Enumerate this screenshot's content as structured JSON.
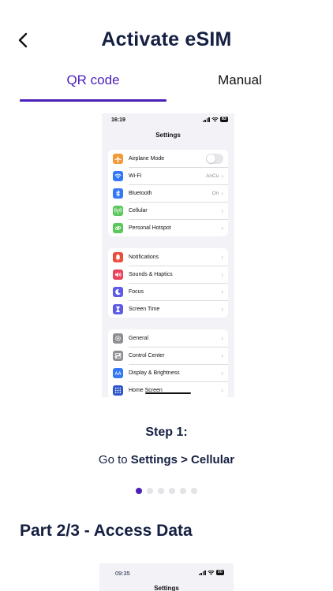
{
  "header": {
    "title": "Activate eSIM",
    "back_icon": "chevron-left-icon"
  },
  "tabs": [
    {
      "label": "QR code",
      "active": true
    },
    {
      "label": "Manual",
      "active": false
    }
  ],
  "colors": {
    "accent": "#4a1fb8",
    "text": "#152042"
  },
  "phone": {
    "time": "16:19",
    "battery": "83",
    "screen_title": "Settings",
    "groups": [
      [
        {
          "label": "Airplane Mode",
          "icon": "airplane-icon",
          "color": "#f19a37",
          "toggle": true
        },
        {
          "label": "Wi-Fi",
          "icon": "wifi-icon",
          "color": "#3478f6",
          "value": "AnCu"
        },
        {
          "label": "Bluetooth",
          "icon": "bluetooth-icon",
          "color": "#3478f6",
          "value": "On"
        },
        {
          "label": "Cellular",
          "icon": "antenna-icon",
          "color": "#5ac85a"
        },
        {
          "label": "Personal Hotspot",
          "icon": "link-icon",
          "color": "#5ac85a"
        }
      ],
      [
        {
          "label": "Notifications",
          "icon": "bell-icon",
          "color": "#eb4d3d"
        },
        {
          "label": "Sounds & Haptics",
          "icon": "speaker-icon",
          "color": "#e9445a"
        },
        {
          "label": "Focus",
          "icon": "moon-icon",
          "color": "#5e5ce6"
        },
        {
          "label": "Screen Time",
          "icon": "hourglass-icon",
          "color": "#5e5ce6"
        }
      ],
      [
        {
          "label": "General",
          "icon": "gear-icon",
          "color": "#8e8e93"
        },
        {
          "label": "Control Center",
          "icon": "switches-icon",
          "color": "#8e8e93"
        },
        {
          "label": "Display & Brightness",
          "icon": "text-size-icon",
          "color": "#3478f6"
        },
        {
          "label": "Home Screen",
          "icon": "grid-icon",
          "color": "#2e54c9"
        }
      ]
    ]
  },
  "step": {
    "title": "Step 1:",
    "prefix": "Go to ",
    "bold": "Settings > Cellular"
  },
  "pagination": {
    "total": 6,
    "active": 1
  },
  "section": {
    "title": "Part 2/3 - Access Data"
  },
  "phone2": {
    "time": "09:35",
    "battery": "88",
    "screen_title": "Settings"
  }
}
